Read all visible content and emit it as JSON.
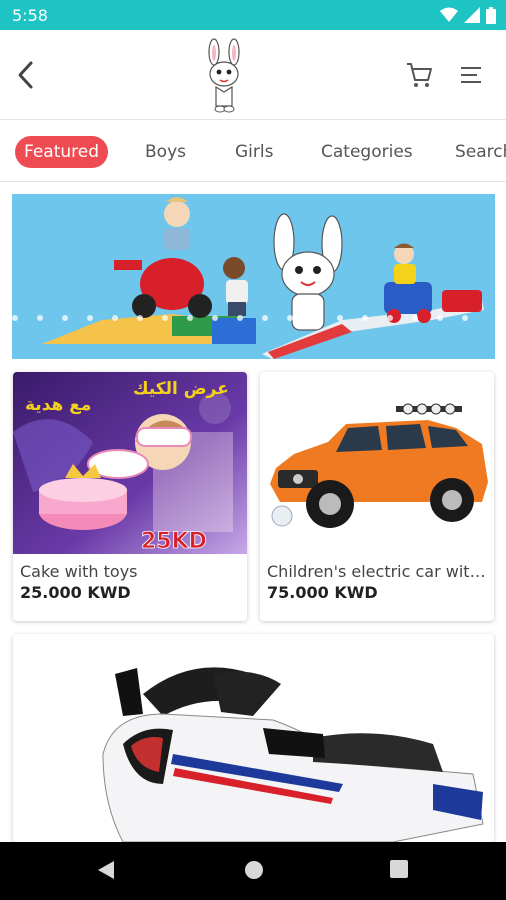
{
  "status_bar": {
    "time": "5:58"
  },
  "header": {
    "logo": "bunny-logo"
  },
  "tabs": [
    {
      "label": "Featured"
    },
    {
      "label": "Boys"
    },
    {
      "label": "Girls"
    },
    {
      "label": "Categories"
    },
    {
      "label": "Search"
    }
  ],
  "products": [
    {
      "title": "Cake with toys",
      "price": "25.000 KWD",
      "image_text_1": "عرض الكيك",
      "image_text_2": "مع هدية",
      "image_text_3": "25KD"
    },
    {
      "title": "Children's electric car wit…",
      "price": "75.000 KWD"
    }
  ],
  "colors": {
    "status_bar": "#1ec4c4",
    "accent": "#ee4b53",
    "hero_bg": "#6ec6ec"
  }
}
